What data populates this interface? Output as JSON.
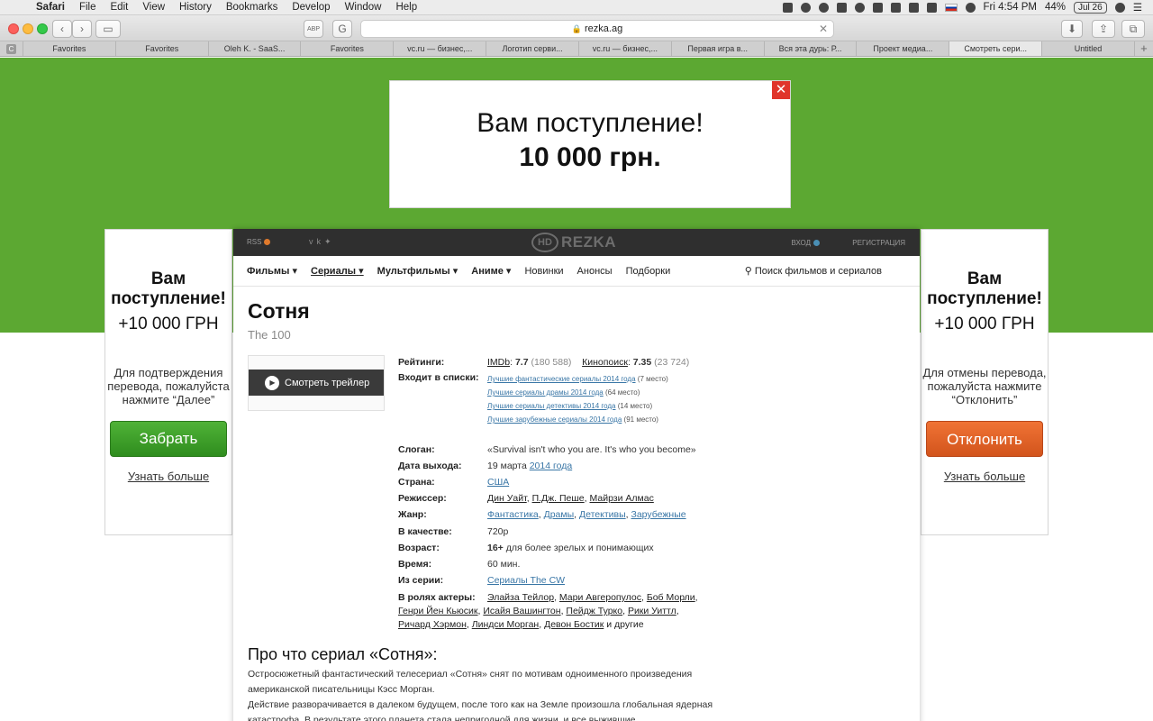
{
  "menubar": {
    "app": "Safari",
    "items": [
      "File",
      "Edit",
      "View",
      "History",
      "Bookmarks",
      "Develop",
      "Window",
      "Help"
    ],
    "clock": "Fri 4:54 PM",
    "battery": "44%",
    "date_badge": "Jul 26"
  },
  "toolbar": {
    "url": "rezka.ag"
  },
  "tabs": [
    "Favorites",
    "Favorites",
    "Oleh K. - SaaS...",
    "Favorites",
    "vc.ru — бизнес,...",
    "Логотип серви...",
    "vc.ru — бизнес,...",
    "Первая игра в...",
    "Вся эта дурь: Р...",
    "Проект медиа...",
    "Смотреть сери...",
    "Untitled"
  ],
  "top_ad": {
    "line1": "Вам поступление!",
    "line2": "10 000 грн."
  },
  "left_ad": {
    "heading": "Вам поступление!",
    "amount": "+10 000 ГРН",
    "message": "Для подтверждения перевода, пожалуйста нажмите “Далее”",
    "button": "Забрать",
    "more": "Узнать больше"
  },
  "right_ad": {
    "heading": "Вам поступление!",
    "amount": "+10 000 ГРН",
    "message": "Для отмены перевода, пожалуйста нажмите “Отклонить”",
    "button": "Отклонить",
    "more": "Узнать больше"
  },
  "site": {
    "rss": "RSS",
    "logo_hd": "HD",
    "logo_name": "REZKA",
    "login": "ВХОД",
    "register": "РЕГИСТРАЦИЯ",
    "nav": [
      "Фильмы",
      "Сериалы",
      "Мультфильмы",
      "Аниме",
      "Новинки",
      "Анонсы",
      "Подборки"
    ],
    "search": "Поиск фильмов и сериалов"
  },
  "movie": {
    "title": "Сотня",
    "original_title": "The 100",
    "trailer": "Смотреть трейлер",
    "labels": {
      "ratings": "Рейтинги:",
      "lists": "Входит в списки:",
      "slogan": "Слоган:",
      "release": "Дата выхода:",
      "country": "Страна:",
      "director": "Режиссер:",
      "genre": "Жанр:",
      "quality": "В качестве:",
      "age": "Возраст:",
      "time": "Время:",
      "series": "Из серии:",
      "actors": "В ролях актеры:"
    },
    "imdb_label": "IMDb",
    "imdb_score": "7.7",
    "imdb_votes": "(180 588)",
    "kp_label": "Кинопоиск",
    "kp_score": "7.35",
    "kp_votes": "(23 724)",
    "lists": [
      {
        "name": "Лучшие фантастические сериалы 2014 года",
        "place": "(7 место)"
      },
      {
        "name": "Лучшие сериалы драмы 2014 года",
        "place": "(64 место)"
      },
      {
        "name": "Лучшие сериалы детективы 2014 года",
        "place": "(14 место)"
      },
      {
        "name": "Лучшие зарубежные сериалы 2014 года",
        "place": "(91 место)"
      }
    ],
    "slogan": "«Survival isn't who you are. It's who you become»",
    "release_day": "19 марта",
    "release_year": "2014 года",
    "country": "США",
    "directors": [
      "Дин Уайт",
      "П.Дж. Пеше",
      "Майрзи Алмас"
    ],
    "genres": [
      "Фантастика",
      "Драмы",
      "Детективы",
      "Зарубежные"
    ],
    "quality": "720p",
    "age_rating": "16+",
    "age_text": "для более зрелых и понимающих",
    "time": "60 мин.",
    "series": "Сериалы The CW",
    "actors_line1": [
      "Элайза Тейлор",
      "Мари Авгеропулос",
      "Боб Морли"
    ],
    "actors_line2": [
      "Генри Йен Кьюсик",
      "Исайя Вашингтон",
      "Пейдж Турко",
      "Рики Уиттл"
    ],
    "actors_line3": [
      "Ричард Хэрмон",
      "Линдси Морган",
      "Девон Бостик"
    ],
    "actors_more": "и другие",
    "about_heading": "Про что сериал «Сотня»:",
    "about_p1": "Остросюжетный фантастический телесериал «Сотня» снят по мотивам одноименного произведения американской писательницы Кэсс Морган.",
    "about_p2": "Действие разворачивается в далеком будущем, после того как на Земле произошла глобальная ядерная катастрофа. В результате этого планета стала непригодной для жизни, и все выжившие"
  },
  "colors": {
    "page_green": "#5ca832",
    "link_blue": "#3976a6",
    "close_red": "#e0352b",
    "accept_green": "#3a9e28",
    "decline_orange": "#e0622a"
  }
}
